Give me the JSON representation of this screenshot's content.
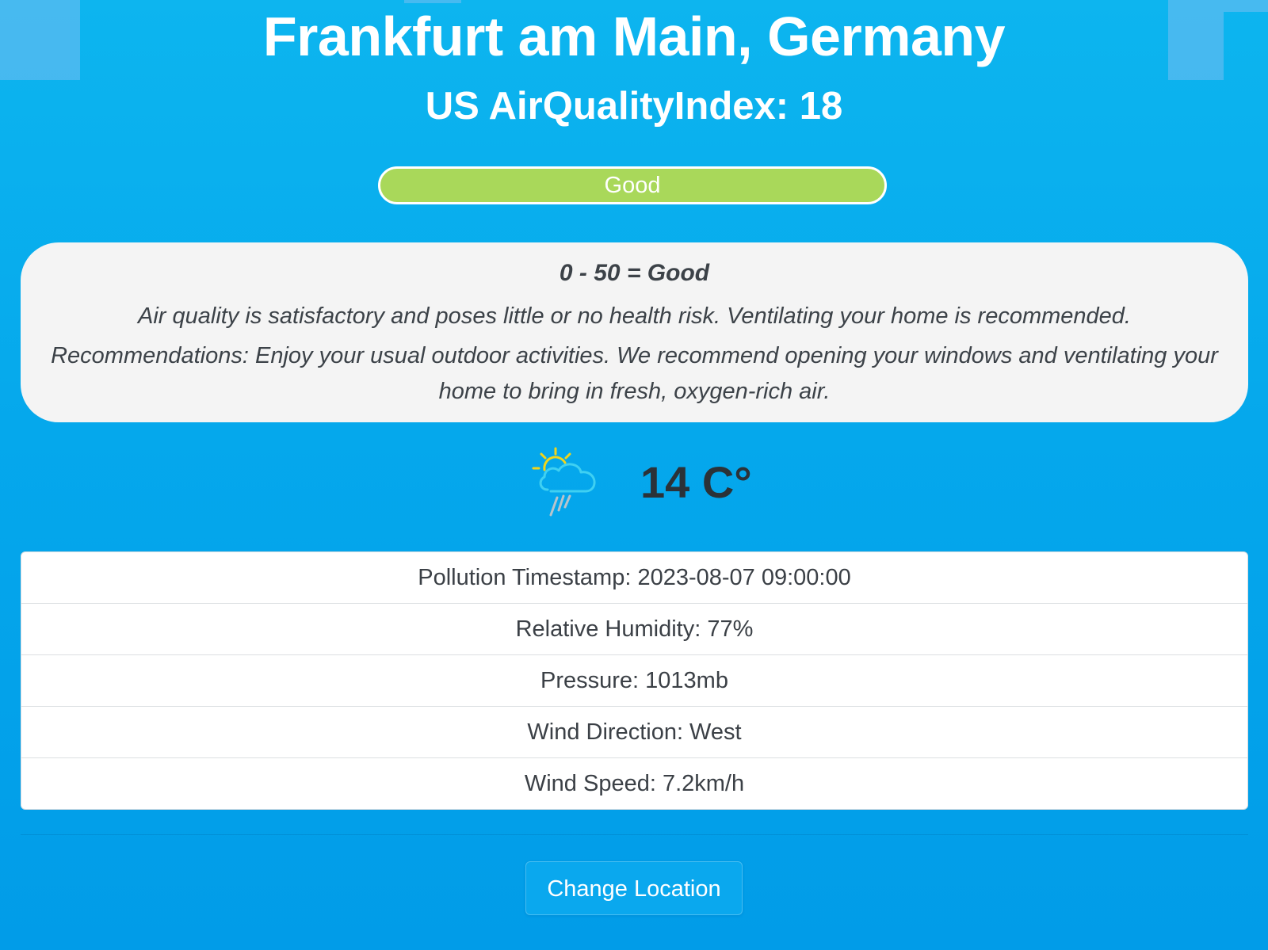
{
  "header": {
    "location": "Frankfurt am Main, Germany",
    "aqi_text": "US AirQualityIndex: 18"
  },
  "aqi_badge": {
    "label": "Good",
    "color": "#a9d85a"
  },
  "info": {
    "range": "0 - 50 = Good",
    "description": "Air quality is satisfactory and poses little or no health risk. Ventilating your home is recommended.",
    "recommendation": "Recommendations: Enjoy your usual outdoor activities. We recommend opening your windows and ventilating your home to bring in fresh, oxygen-rich air."
  },
  "weather": {
    "icon": "sun-cloud-rain-icon",
    "temperature": "14 C°"
  },
  "details": [
    {
      "text": "Pollution Timestamp: 2023-08-07 09:00:00"
    },
    {
      "text": "Relative Humidity: 77%"
    },
    {
      "text": "Pressure: 1013mb"
    },
    {
      "text": "Wind Direction: West"
    },
    {
      "text": "Wind Speed: 7.2km/h"
    }
  ],
  "actions": {
    "change_location": "Change Location"
  },
  "colors": {
    "background": "#05a8ec",
    "card": "#f4f4f4",
    "badge_good": "#a9d85a"
  }
}
